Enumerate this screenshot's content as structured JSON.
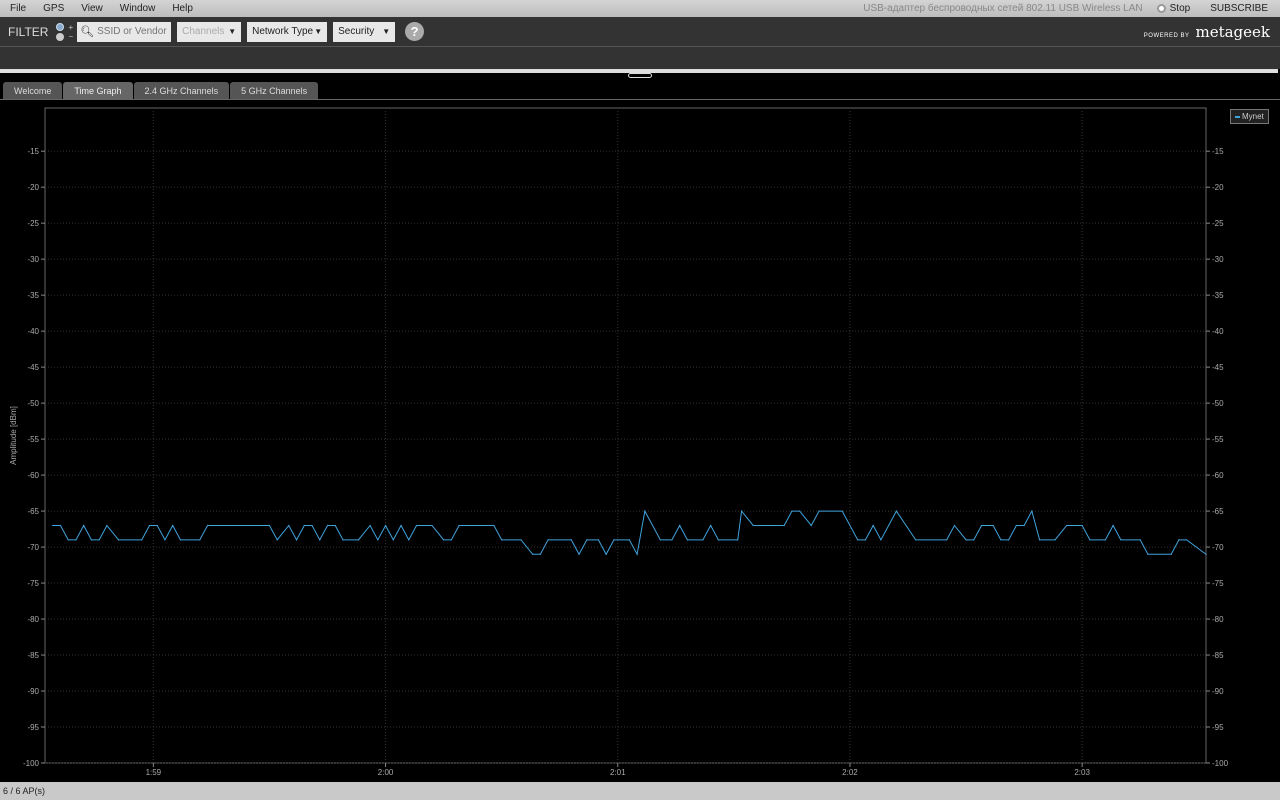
{
  "menu": {
    "items": [
      "File",
      "GPS",
      "View",
      "Window",
      "Help"
    ],
    "adapter": "USB-адаптер беспроводных сетей 802.11 USB Wireless LAN",
    "stop_label": "Stop",
    "subscribe_label": "SUBSCRIBE"
  },
  "toolbar": {
    "filter_label": "FILTER",
    "plus": "+",
    "minus": "−",
    "search_placeholder": "SSID or Vendor",
    "channels": "Channels",
    "network_type": "Network Type",
    "security": "Security",
    "help": "?",
    "powered_by": "POWERED BY",
    "brand": "metageek"
  },
  "tabs": [
    {
      "label": "Welcome"
    },
    {
      "label": "Time Graph"
    },
    {
      "label": "2.4 GHz Channels"
    },
    {
      "label": "5 GHz Channels"
    }
  ],
  "status": {
    "ap_count": "6 / 6 AP(s)"
  },
  "colors": {
    "series": "#3fa3dc",
    "grid": "#333333"
  },
  "chart_data": {
    "type": "line",
    "ylabel": "Amplitude [dBm]",
    "xlabel": "",
    "ylim": [
      -100,
      -9
    ],
    "yticks": [
      -15,
      -20,
      -25,
      -30,
      -35,
      -40,
      -45,
      -50,
      -55,
      -60,
      -65,
      -70,
      -75,
      -80,
      -85,
      -90,
      -95,
      -100
    ],
    "xlim_seconds_after_1_58": [
      32,
      332
    ],
    "xticks": [
      {
        "t": 60,
        "label": "1:59"
      },
      {
        "t": 120,
        "label": "2:00"
      },
      {
        "t": 180,
        "label": "2:01"
      },
      {
        "t": 240,
        "label": "2:02"
      },
      {
        "t": 300,
        "label": "2:03"
      }
    ],
    "grid": true,
    "legend": "top-right",
    "series": [
      {
        "name": "Mynet",
        "color": "#3fa3dc",
        "points": [
          [
            34,
            -67
          ],
          [
            36,
            -67
          ],
          [
            38,
            -69
          ],
          [
            40,
            -69
          ],
          [
            42,
            -67
          ],
          [
            44,
            -69
          ],
          [
            46,
            -69
          ],
          [
            48,
            -67
          ],
          [
            51,
            -69
          ],
          [
            57,
            -69
          ],
          [
            59,
            -67
          ],
          [
            61,
            -67
          ],
          [
            63,
            -69
          ],
          [
            65,
            -67
          ],
          [
            67,
            -69
          ],
          [
            72,
            -69
          ],
          [
            74,
            -67
          ],
          [
            90,
            -67
          ],
          [
            92,
            -69
          ],
          [
            95,
            -67
          ],
          [
            97,
            -69
          ],
          [
            99,
            -67
          ],
          [
            101,
            -67
          ],
          [
            103,
            -69
          ],
          [
            105,
            -67
          ],
          [
            107,
            -67
          ],
          [
            109,
            -69
          ],
          [
            113,
            -69
          ],
          [
            116,
            -67
          ],
          [
            118,
            -69
          ],
          [
            120,
            -67
          ],
          [
            122,
            -69
          ],
          [
            124,
            -67
          ],
          [
            126,
            -69
          ],
          [
            128,
            -67
          ],
          [
            132,
            -67
          ],
          [
            135,
            -69
          ],
          [
            137,
            -69
          ],
          [
            139,
            -67
          ],
          [
            148,
            -67
          ],
          [
            150,
            -69
          ],
          [
            155,
            -69
          ],
          [
            158,
            -71
          ],
          [
            160,
            -71
          ],
          [
            162,
            -69
          ],
          [
            168,
            -69
          ],
          [
            170,
            -71
          ],
          [
            172,
            -69
          ],
          [
            175,
            -69
          ],
          [
            177,
            -71
          ],
          [
            179,
            -69
          ],
          [
            183,
            -69
          ],
          [
            185,
            -71
          ],
          [
            187,
            -65
          ],
          [
            191,
            -69
          ],
          [
            194,
            -69
          ],
          [
            196,
            -67
          ],
          [
            198,
            -69
          ],
          [
            202,
            -69
          ],
          [
            204,
            -67
          ],
          [
            206,
            -69
          ],
          [
            211,
            -69
          ],
          [
            212,
            -65
          ],
          [
            215,
            -67
          ],
          [
            223,
            -67
          ],
          [
            225,
            -65
          ],
          [
            227,
            -65
          ],
          [
            230,
            -67
          ],
          [
            232,
            -65
          ],
          [
            238,
            -65
          ],
          [
            242,
            -69
          ],
          [
            244,
            -69
          ],
          [
            246,
            -67
          ],
          [
            248,
            -69
          ],
          [
            252,
            -65
          ],
          [
            257,
            -69
          ],
          [
            265,
            -69
          ],
          [
            267,
            -67
          ],
          [
            270,
            -69
          ],
          [
            272,
            -69
          ],
          [
            274,
            -67
          ],
          [
            277,
            -67
          ],
          [
            279,
            -69
          ],
          [
            281,
            -69
          ],
          [
            283,
            -67
          ],
          [
            285,
            -67
          ],
          [
            287,
            -65
          ],
          [
            289,
            -69
          ],
          [
            293,
            -69
          ],
          [
            296,
            -67
          ],
          [
            300,
            -67
          ],
          [
            302,
            -69
          ],
          [
            306,
            -69
          ],
          [
            308,
            -67
          ],
          [
            310,
            -69
          ],
          [
            315,
            -69
          ],
          [
            317,
            -71
          ],
          [
            323,
            -71
          ],
          [
            325,
            -69
          ],
          [
            327,
            -69
          ],
          [
            332,
            -71
          ]
        ]
      }
    ]
  }
}
